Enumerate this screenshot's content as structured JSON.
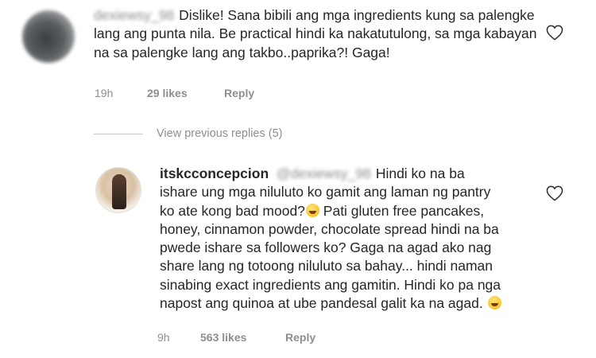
{
  "comments": [
    {
      "username_blurred": "dexiewsy_98",
      "text": "Dislike! Sana bibili ang mga ingredients kung sa palengke lang ang punta nila. Be practical hindi ka nakatutulong, sa mga kabayan na sa palengke lang ang takbo..paprika?! Gaga!",
      "time": "19h",
      "likes": "29 likes",
      "reply_label": "Reply"
    },
    {
      "username": "itskcconcepcion",
      "mention_blurred": "@dexiewsy_98",
      "text_part1": "Hindi ko na ba ishare ung  mga niluluto ko gamit ang laman ng pantry ko ate kong bad mood?",
      "text_part2": " Pati gluten free pancakes, honey, cinnamon powder, chocolate spread hindi na ba pwede ishare sa followers ko? Gaga na agad ako nag share lang ng totoong niluluto sa bahay... hindi naman sinabing exact ingredients ang gamitin. Hindi ko pa nga napost ang quinoa at ube pandesal galit ka na agad.",
      "time": "9h",
      "likes": "563 likes",
      "reply_label": "Reply"
    }
  ],
  "view_previous_replies": "View previous replies (5)",
  "colors": {
    "text": "#262626",
    "secondary": "#8e8e8e",
    "emoji": "#f7c52b"
  },
  "icons": [
    "heart-outline-icon",
    "grinning-emoji-icon"
  ]
}
